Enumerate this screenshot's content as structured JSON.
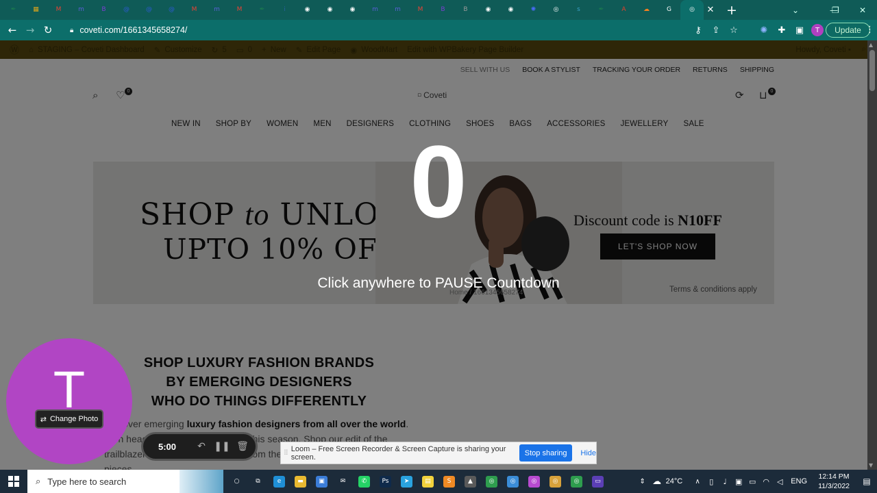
{
  "browser": {
    "tabs": [
      {
        "icon": "quill-icon",
        "color": "#1b7a4f",
        "glyph": "✒"
      },
      {
        "icon": "calendar-icon",
        "color": "#d9a31d",
        "glyph": "▦"
      },
      {
        "icon": "gmail-icon",
        "color": "#ea4335",
        "glyph": "M"
      },
      {
        "icon": "meetup-icon",
        "color": "#5a5fd8",
        "glyph": "m"
      },
      {
        "icon": "bootstrap-icon",
        "color": "#7a3fd1",
        "glyph": "B"
      },
      {
        "icon": "at-sign-icon",
        "color": "#2d5bd6",
        "glyph": "@"
      },
      {
        "icon": "at-sign-icon",
        "color": "#2d5bd6",
        "glyph": "@"
      },
      {
        "icon": "at-sign-icon",
        "color": "#2d5bd6",
        "glyph": "@"
      },
      {
        "icon": "gmail-icon",
        "color": "#ea4335",
        "glyph": "M"
      },
      {
        "icon": "meetup-icon",
        "color": "#5a5fd8",
        "glyph": "m"
      },
      {
        "icon": "gmail-icon",
        "color": "#ea4335",
        "glyph": "M"
      },
      {
        "icon": "quill-icon",
        "color": "#1b7a4f",
        "glyph": "✒"
      },
      {
        "icon": "info-icon",
        "color": "#2a5fa0",
        "glyph": "i"
      },
      {
        "icon": "globe-icon",
        "color": "#ffffff",
        "glyph": "◉"
      },
      {
        "icon": "globe-icon",
        "color": "#ffffff",
        "glyph": "◉"
      },
      {
        "icon": "globe-icon",
        "color": "#ffffff",
        "glyph": "◉"
      },
      {
        "icon": "meetup-icon",
        "color": "#5a5fd8",
        "glyph": "m"
      },
      {
        "icon": "meetup-icon",
        "color": "#5a5fd8",
        "glyph": "m"
      },
      {
        "icon": "gmail-icon",
        "color": "#ea4335",
        "glyph": "M"
      },
      {
        "icon": "bootstrap-icon",
        "color": "#7a3fd1",
        "glyph": "B"
      },
      {
        "icon": "letter-b-icon",
        "color": "#9a9a9a",
        "glyph": "B"
      },
      {
        "icon": "globe-icon",
        "color": "#ffffff",
        "glyph": "◉"
      },
      {
        "icon": "globe-icon",
        "color": "#ffffff",
        "glyph": "◉"
      },
      {
        "icon": "gear-icon",
        "color": "#4a6cf7",
        "glyph": "✺"
      },
      {
        "icon": "chrome-icon",
        "color": "#ffffff",
        "glyph": "◎"
      },
      {
        "icon": "sts-icon",
        "color": "#3aa0c8",
        "glyph": "s"
      },
      {
        "icon": "quill-icon",
        "color": "#1b7a4f",
        "glyph": "✒"
      },
      {
        "icon": "acrobat-icon",
        "color": "#e2402c",
        "glyph": "A"
      },
      {
        "icon": "cloud-icon",
        "color": "#f38020",
        "glyph": "☁"
      },
      {
        "icon": "google-icon",
        "color": "#ffffff",
        "glyph": "G"
      }
    ],
    "active_tab": {
      "icon": "chrome-icon",
      "glyph": "◎",
      "close": "✕"
    },
    "new_tab": "+",
    "url": "coveti.com/1661345658274/",
    "avatar_initial": "T",
    "update_label": "Update"
  },
  "adminbar": {
    "items": [
      "STAGING – Coveti Dashboard",
      "Customize",
      "5",
      "0",
      "New",
      "Edit Page",
      "WoodMart",
      "Edit with WPBakery Page Builder"
    ],
    "howdy": "Howdy, Coveti"
  },
  "site": {
    "topnav": [
      "SELL WITH US",
      "BOOK A STYLIST",
      "TRACKING YOUR ORDER",
      "RETURNS",
      "SHIPPING"
    ],
    "wishlist_count": "0",
    "cart_count": "0",
    "logo_alt": "Coveti",
    "mainnav": [
      "NEW IN",
      "SHOP BY",
      "WOMEN",
      "MEN",
      "DESIGNERS",
      "CLOTHING",
      "SHOES",
      "BAGS",
      "ACCESSORIES",
      "JEWELLERY",
      "SALE"
    ],
    "banner": {
      "title_a": "SHOP",
      "title_b": "to",
      "title_c": "UNLOCK",
      "subtitle": "UPTO 10% OFF",
      "discount_prefix": "Discount code is ",
      "discount_code": "N10FF",
      "cta": "LET'S SHOP NOW",
      "terms": "Terms & conditions apply",
      "breadcrumb": "Home / 1661345658274"
    },
    "tagline": [
      "SHOP LUXURY FASHION BRANDS",
      "BY EMERGING DESIGNERS",
      "WHO DO THINGS DIFFERENTLY"
    ],
    "para_a": "Discover emerging ",
    "para_b": "luxury fashion designers from all over the world",
    "para_c": ". Turn heads back to your own way this season. Shop our edit of the trailblazers who set the trends — from the latest must-haves to classic pieces."
  },
  "countdown": {
    "number": "0",
    "message": "Click anywhere to PAUSE Countdown"
  },
  "loom": {
    "initial": "T",
    "change_photo": "Change Photo",
    "timer": "5:00",
    "share_text": "Loom – Free Screen Recorder & Screen Capture is sharing your screen.",
    "stop_sharing": "Stop sharing",
    "hide": "Hide"
  },
  "taskbar": {
    "search_placeholder": "Type here to search",
    "temperature": "24°C",
    "language": "ENG",
    "time": "12:14 PM",
    "date": "11/3/2022",
    "apps": [
      {
        "icon": "cortana-icon",
        "glyph": "○",
        "color": "transparent"
      },
      {
        "icon": "task-view-icon",
        "glyph": "⧉",
        "color": "transparent"
      },
      {
        "icon": "edge-icon",
        "glyph": "e",
        "color": "#1f8fd6"
      },
      {
        "icon": "folder-icon",
        "glyph": "▬",
        "color": "#e8b931"
      },
      {
        "icon": "store-icon",
        "glyph": "▣",
        "color": "#3b7dd8"
      },
      {
        "icon": "mail-icon",
        "glyph": "✉",
        "color": "transparent"
      },
      {
        "icon": "whatsapp-icon",
        "glyph": "✆",
        "color": "#25d366"
      },
      {
        "icon": "photoshop-icon",
        "glyph": "Ps",
        "color": "#0f2a4a"
      },
      {
        "icon": "telegram-icon",
        "glyph": "➤",
        "color": "#2aa3df"
      },
      {
        "icon": "sticky-notes-icon",
        "glyph": "▤",
        "color": "#f2d23c"
      },
      {
        "icon": "sublime-icon",
        "glyph": "S",
        "color": "#f08a24"
      },
      {
        "icon": "photos-icon",
        "glyph": "▲",
        "color": "#5a5a5a"
      },
      {
        "icon": "chrome-icon",
        "glyph": "◎",
        "color": "#2e9d4e"
      },
      {
        "icon": "chrome-icon",
        "glyph": "◎",
        "color": "#3b8dd8"
      },
      {
        "icon": "chrome-icon",
        "glyph": "◎",
        "color": "#b84bd0"
      },
      {
        "icon": "chrome-icon",
        "glyph": "◎",
        "color": "#d8a23b"
      },
      {
        "icon": "chrome-icon",
        "glyph": "◎",
        "color": "#2e9d4e"
      },
      {
        "icon": "terminal-icon",
        "glyph": "▭",
        "color": "#5b3fb5"
      }
    ]
  },
  "colors": {
    "chrome_teal": "#0c6e6a",
    "loom_purple": "#b145c4",
    "stop_blue": "#1a73e8"
  }
}
